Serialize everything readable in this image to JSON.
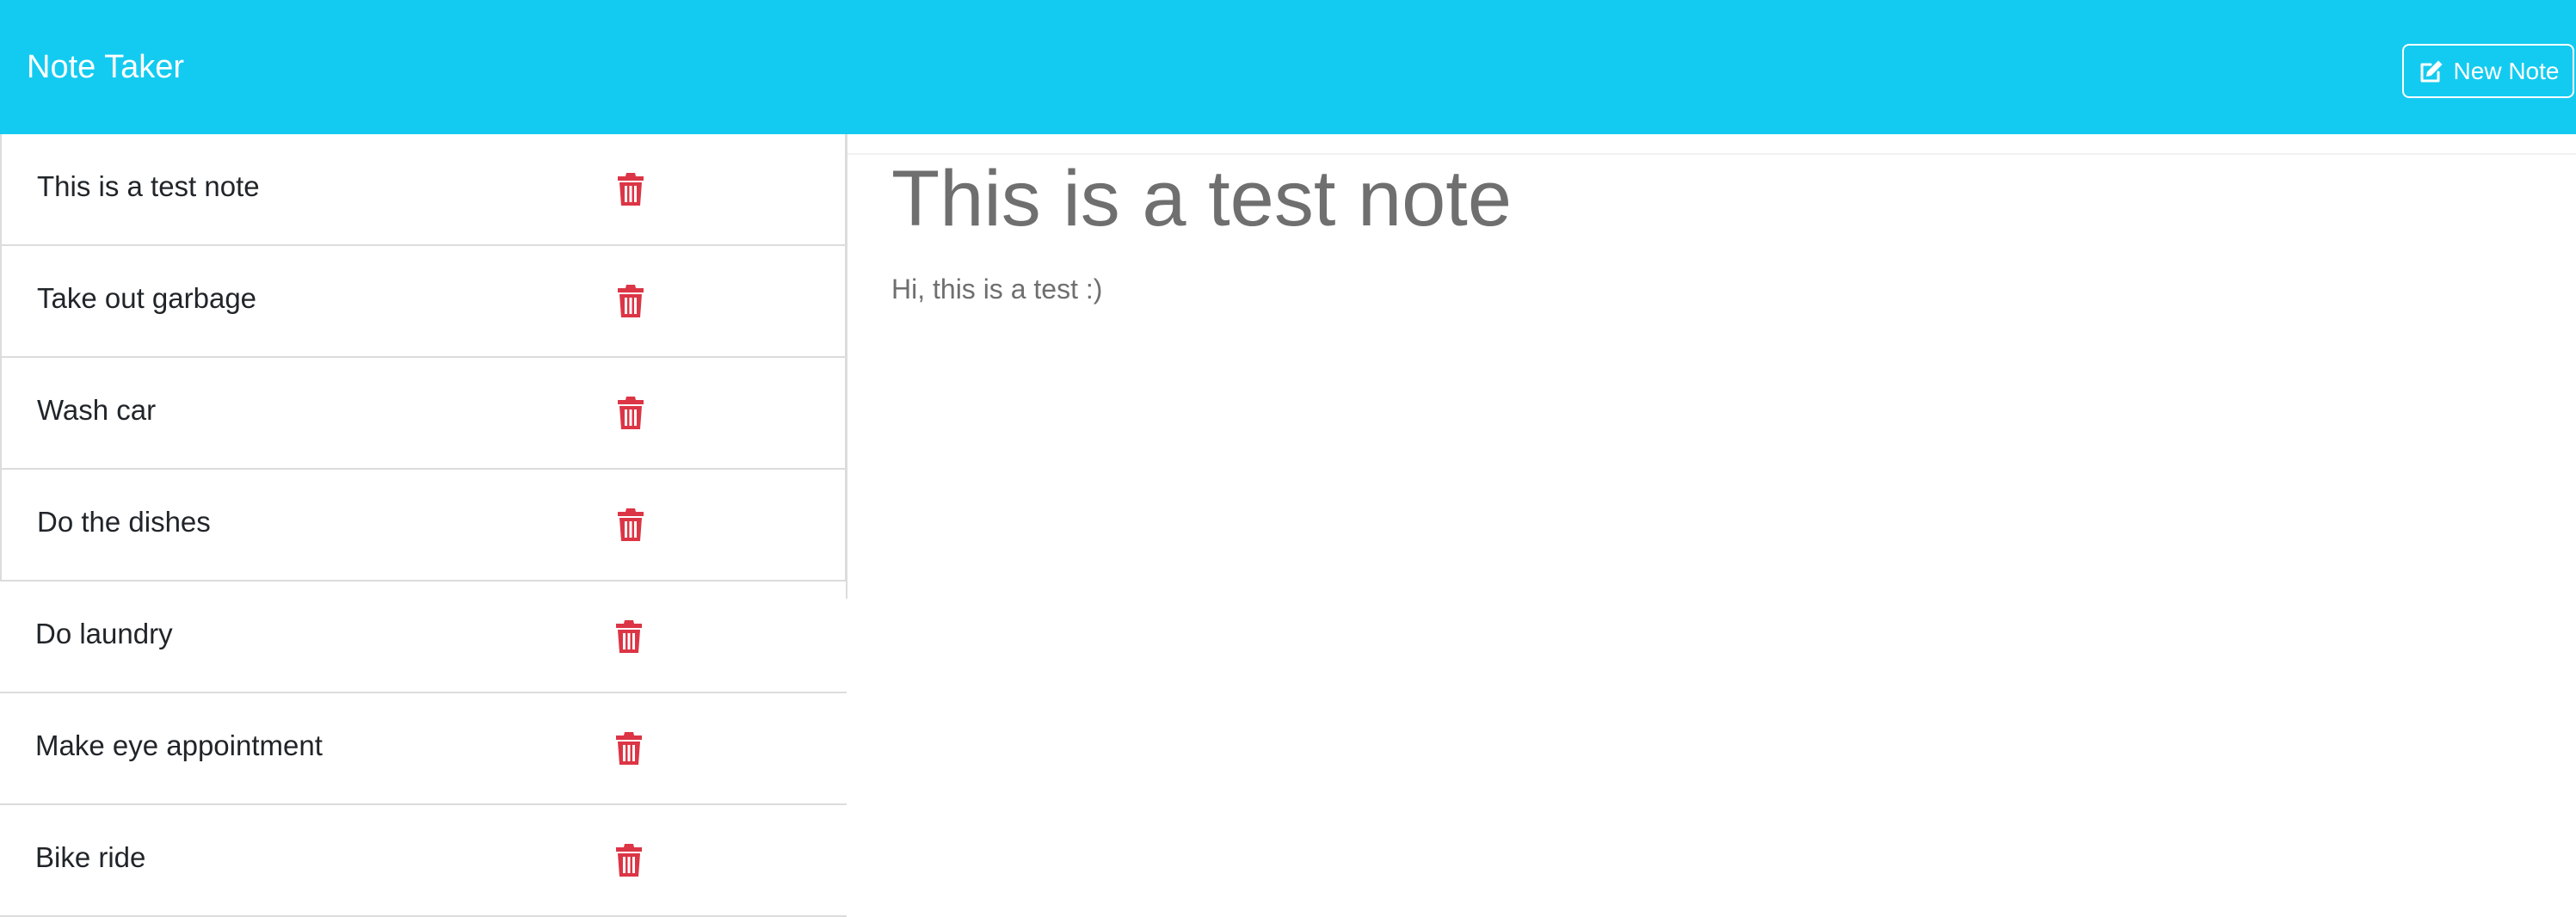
{
  "navbar": {
    "brand": "Note Taker",
    "new_note_label": "New Note",
    "new_note_icon": "pen-to-square-icon",
    "background_color": "#13cbf0"
  },
  "notes": [
    {
      "title": "This is a test note"
    },
    {
      "title": "Take out garbage"
    },
    {
      "title": "Wash car"
    },
    {
      "title": "Do the dishes"
    },
    {
      "title": "Do laundry"
    },
    {
      "title": "Make eye appointment"
    },
    {
      "title": "Bike ride"
    }
  ],
  "delete_icon": "trash-icon",
  "delete_color": "#dc3545",
  "active_note": {
    "title": "This is a test note",
    "text": "Hi, this is a test :)"
  }
}
